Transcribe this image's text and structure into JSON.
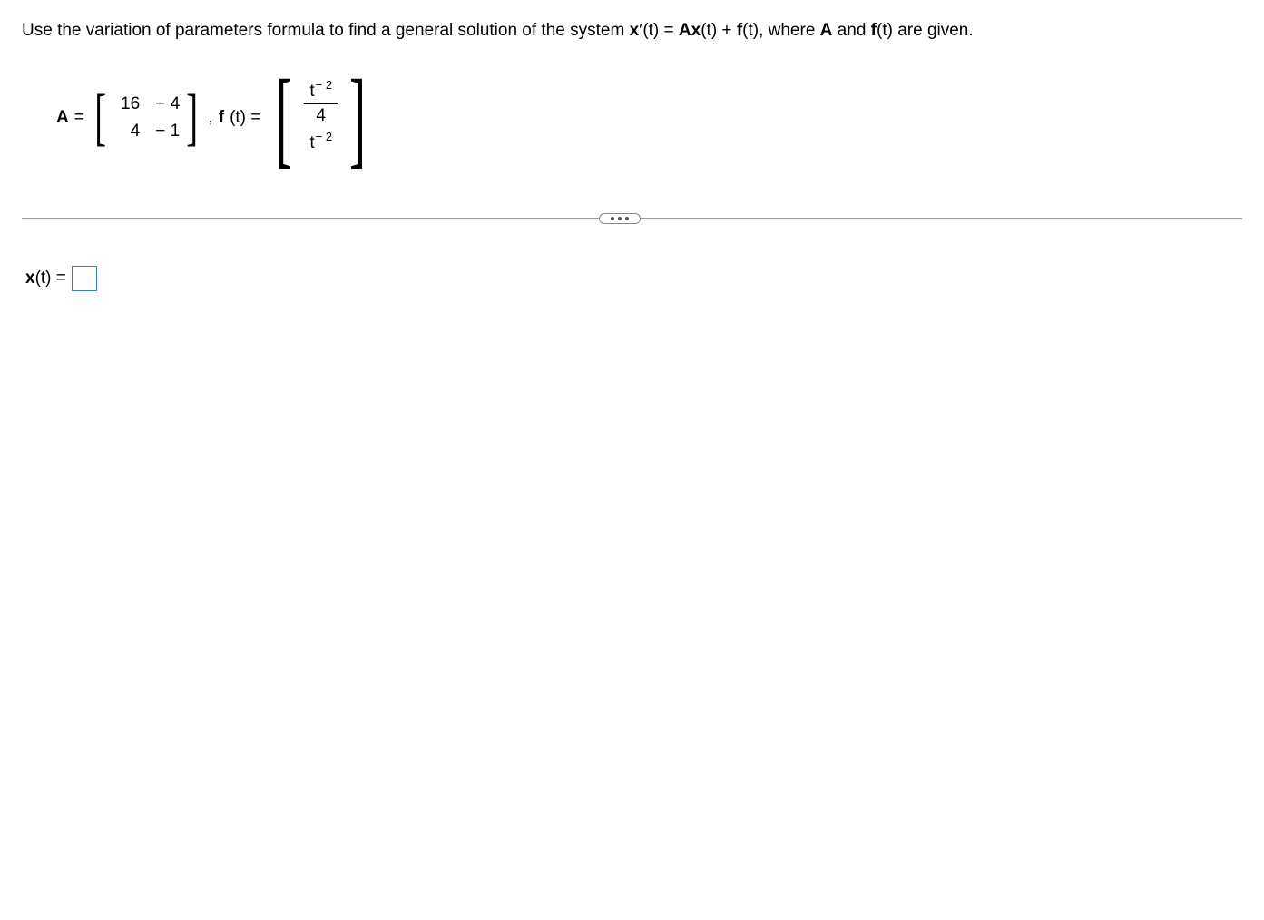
{
  "problem": {
    "prefix": "Use the variation of parameters formula to find a general solution of the system ",
    "eq_lhs": "x",
    "eq_prime": "′",
    "eq_arg1": "(t) = ",
    "eq_A": "A",
    "eq_mid": "x",
    "eq_arg2": "(t) + ",
    "eq_f": "f",
    "eq_arg3": "(t), where ",
    "eq_A2": "A",
    "eq_and": " and ",
    "eq_f2": "f",
    "eq_arg4": "(t) are given."
  },
  "matrixA": {
    "label_A": "A",
    "equals": " = ",
    "r1c1": "16",
    "r1c2": "− 4",
    "r2c1": "4",
    "r2c2": "− 1"
  },
  "comma": ", ",
  "vectorF": {
    "label_f": "f",
    "label_arg": "(t) = ",
    "top_base": "t",
    "top_exp": "− 2",
    "mid": "4",
    "bot_base": "t",
    "bot_exp": "− 2"
  },
  "answer": {
    "label_x": "x",
    "label_arg": "(t) = "
  },
  "icons": {
    "ellipsis": "more-options"
  }
}
